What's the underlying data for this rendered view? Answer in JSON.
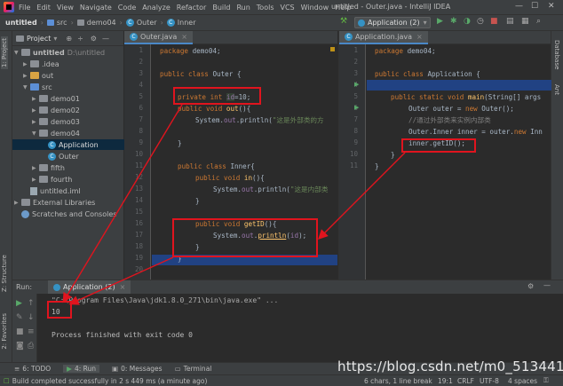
{
  "menubar": {
    "items": [
      "File",
      "Edit",
      "View",
      "Navigate",
      "Code",
      "Analyze",
      "Refactor",
      "Build",
      "Run",
      "Tools",
      "VCS",
      "Window",
      "Help"
    ],
    "window_title": "untitled - Outer.java - IntelliJ IDEA"
  },
  "navbar": {
    "crumbs": [
      "untitled",
      "src",
      "demo04",
      "Outer",
      "Inner"
    ],
    "run_config": "Application (2)"
  },
  "left_strip": {
    "project": "1: Project",
    "structure": "Z: Structure",
    "favorites": "2: Favorites"
  },
  "right_strip": {
    "database": "Database",
    "ant": "Ant"
  },
  "project_panel": {
    "title": "Project",
    "tree": [
      {
        "label": "untitled",
        "suffix": "D:\\untitled"
      },
      {
        "label": ".idea"
      },
      {
        "label": "out"
      },
      {
        "label": "src"
      },
      {
        "label": "demo01"
      },
      {
        "label": "demo02"
      },
      {
        "label": "demo03"
      },
      {
        "label": "demo04"
      },
      {
        "label": "Application"
      },
      {
        "label": "Outer"
      },
      {
        "label": "fifth"
      },
      {
        "label": "fourth"
      },
      {
        "label": "untitled.iml"
      },
      {
        "label": "External Libraries"
      },
      {
        "label": "Scratches and Consoles"
      }
    ]
  },
  "editor_left": {
    "tab": "Outer.java",
    "line_numbers": [
      "1",
      "2",
      "3",
      "4",
      "5",
      "6",
      "7",
      "8",
      "9",
      "10",
      "11",
      "12",
      "13",
      "14",
      "15",
      "16",
      "17",
      "18",
      "19",
      "20",
      "21"
    ],
    "lines": {
      "l1_kw": "package",
      "l1_rest": " demo04;",
      "l3_kw": "public class",
      "l3_rest": " Outer {",
      "l5_kw": "private int",
      "l5_fld": "id",
      "l5_rest": "=10;",
      "l6_kw": "public void",
      "l6_fn": "out",
      "l6_rest": "(){",
      "l7_a": "System.",
      "l7_fld": "out",
      "l7_b": ".println(",
      "l7_str": "\"这是外部类的方",
      "l9": "}",
      "l11_kw": "public class",
      "l11_rest": " Inner{",
      "l12_kw": "public void",
      "l12_fn": "in",
      "l12_rest": "(){",
      "l13_a": "System.",
      "l13_fld": "out",
      "l13_b": ".println(",
      "l13_str": "\"这是内部类",
      "l14": "}",
      "l16_kw": "public void",
      "l16_fn": "getID",
      "l16_rest": "(){",
      "l17_a": "System.",
      "l17_fld": "out",
      "l17_b": ".",
      "l17_fn": "println",
      "l17_c": "(",
      "l17_fld2": "id",
      "l17_d": ");",
      "l18": "}",
      "l19": "}"
    }
  },
  "editor_right": {
    "tab": "Application.java",
    "line_numbers": [
      "1",
      "2",
      "3",
      "4",
      "5",
      "6",
      "7",
      "8",
      "9",
      "10",
      "11"
    ],
    "lines": {
      "l1_kw": "package",
      "l1_rest": " demo04;",
      "l3_kw": "public class",
      "l3_rest": " Application {",
      "l5_kw": "public static void",
      "l5_fn": "main",
      "l5_rest": "(String[] args",
      "l6_a": "Outer outer = ",
      "l6_kw": "new",
      "l6_b": " Outer();",
      "l7_cmt": "//通过外部类来实例内部类",
      "l8_a": "Outer.Inner inner = outer.",
      "l8_kw": "new",
      "l8_b": " Inn",
      "l9": "inner.getID();",
      "l10": "}",
      "l11": "}"
    }
  },
  "run_panel": {
    "label": "Run:",
    "tab": "Application (2)",
    "cmd": "\"C:\\Program Files\\Java\\jdk1.8.0_271\\bin\\java.exe\" ...",
    "output": "10",
    "finished": "Process finished with exit code 0"
  },
  "bottom_tabs": [
    "6: TODO",
    "4: Run",
    "0: Messages",
    "Terminal"
  ],
  "status": {
    "message": "Build completed successfully in 2 s 449 ms (a minute ago)",
    "chars": "6 chars, 1 line break",
    "position": "19:1",
    "line_sep": "CRLF",
    "encoding": "UTF-8",
    "indent": "4 spaces"
  },
  "watermark": "https://blog.csdn.net/m0_51344172"
}
